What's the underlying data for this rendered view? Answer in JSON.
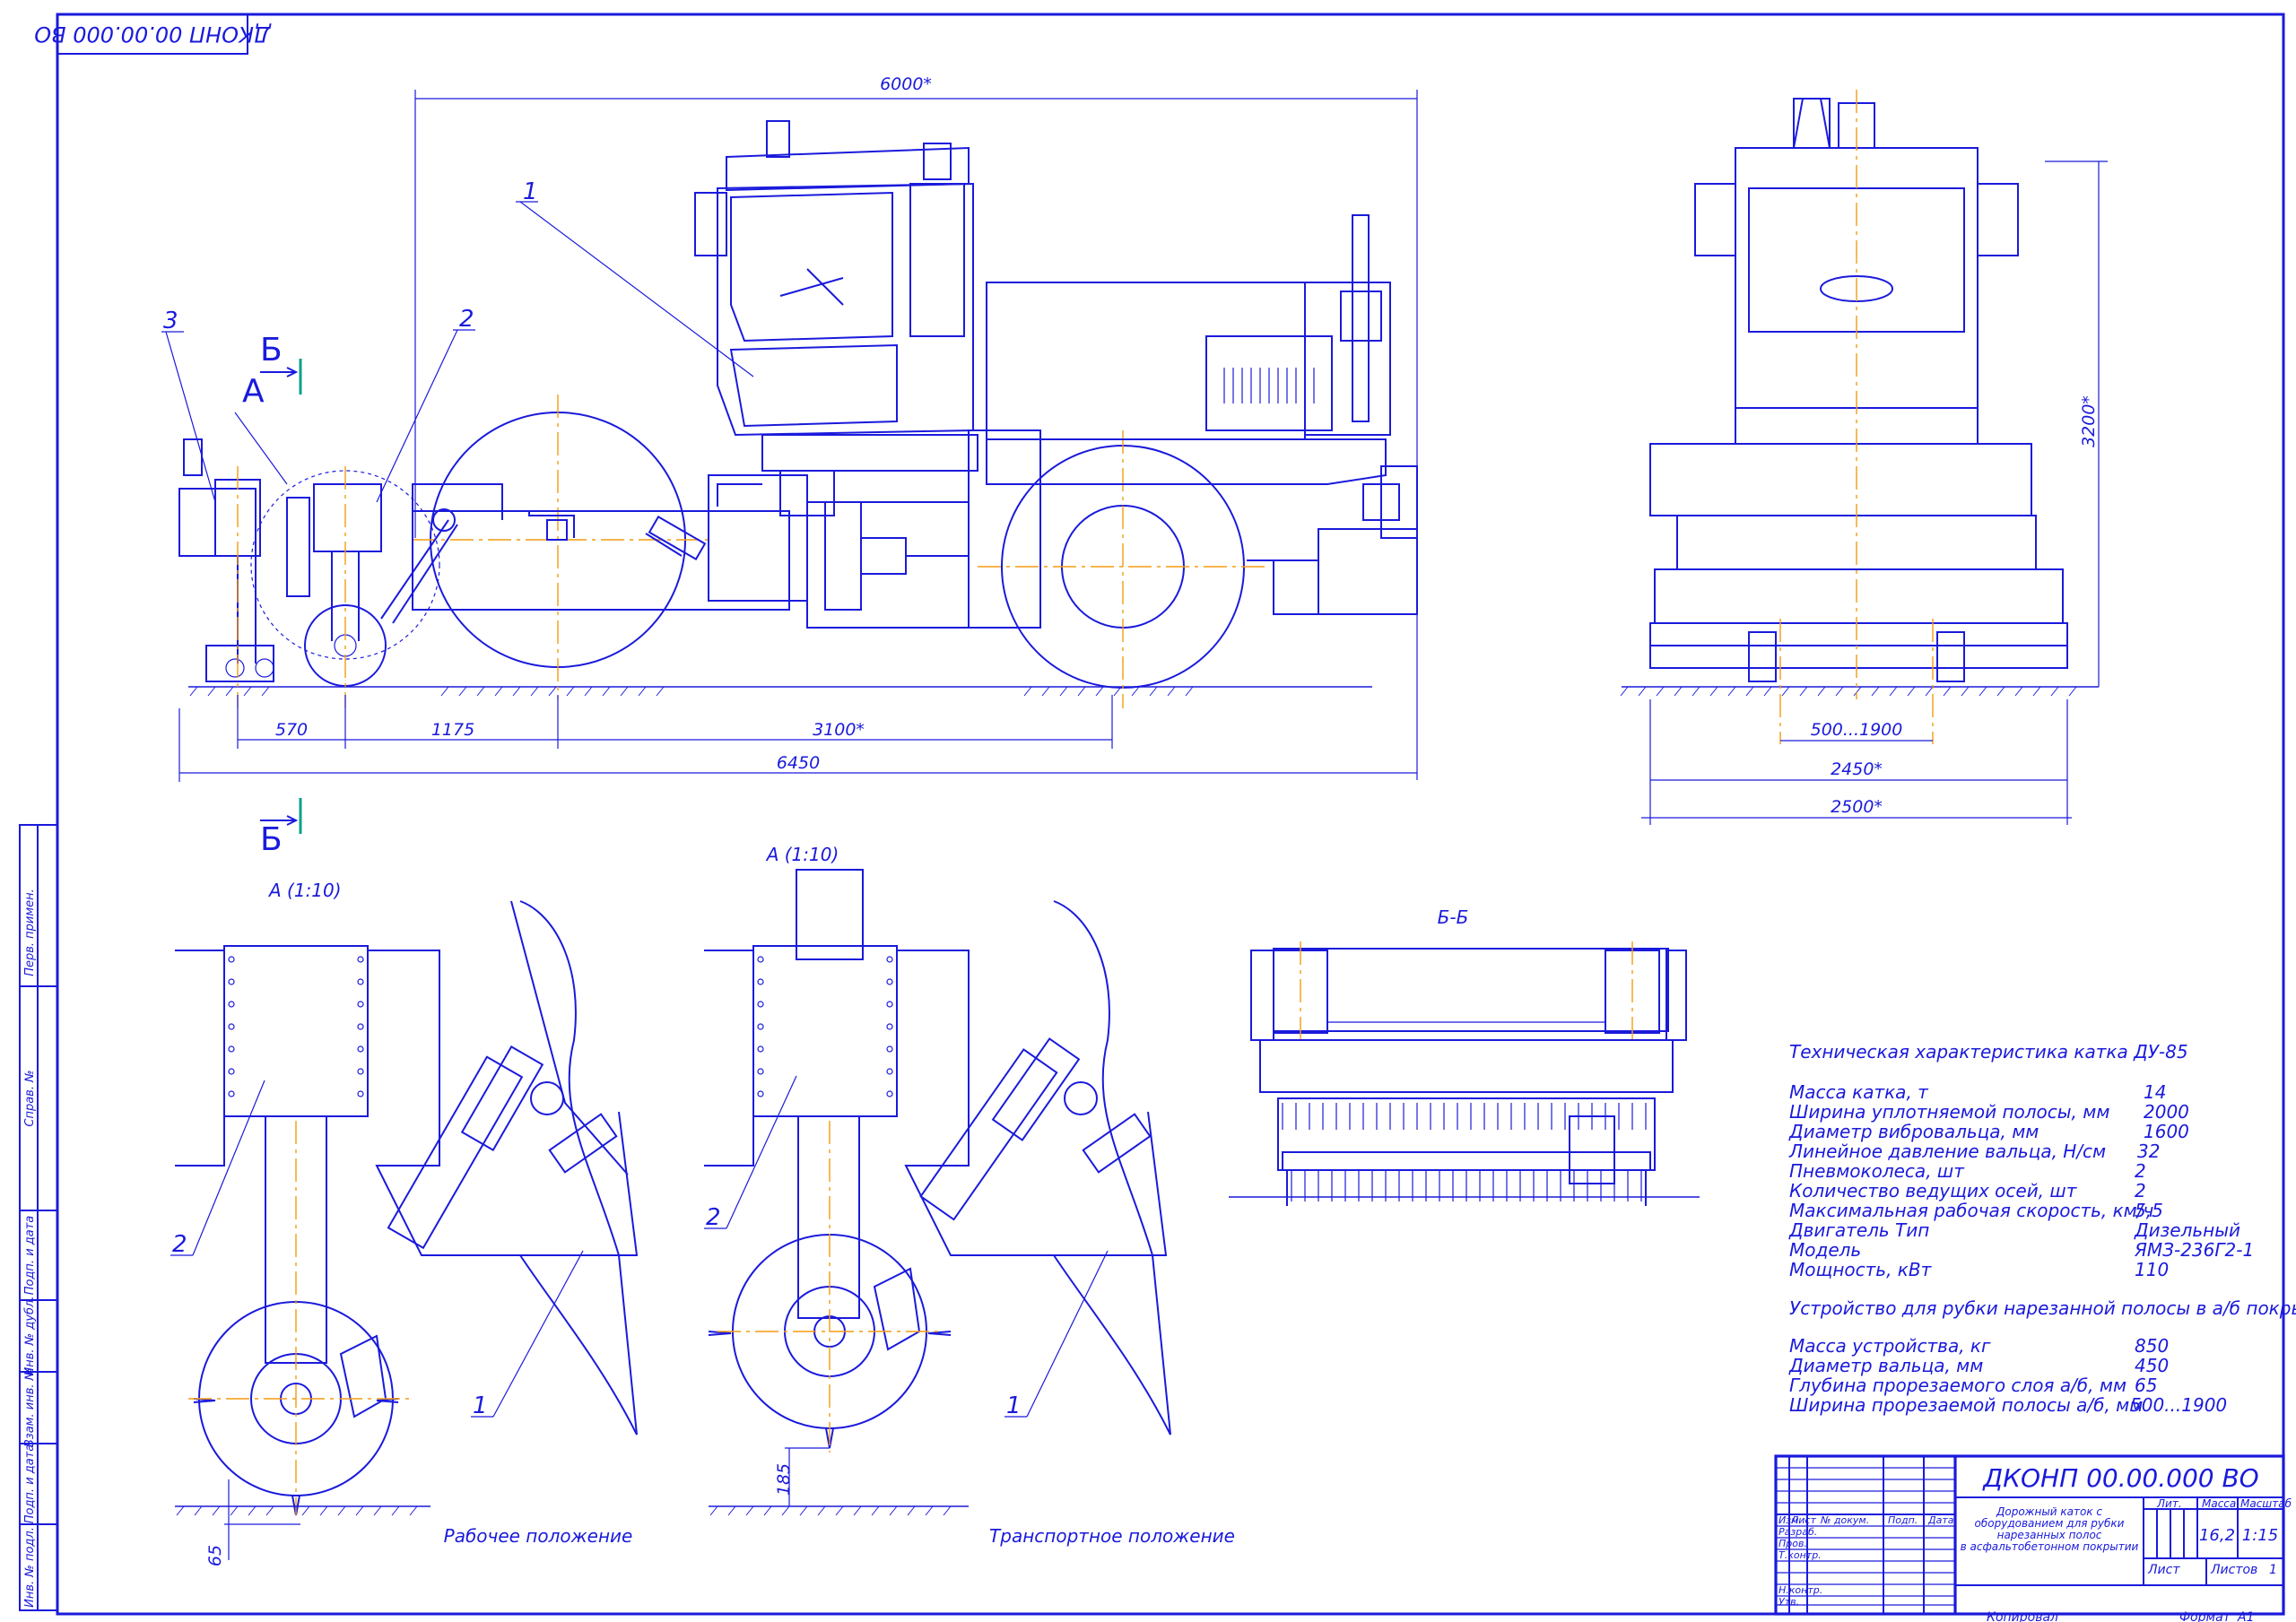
{
  "stamp": {
    "code_rotated": "ДКОНП 00.00.000 ВО"
  },
  "main_view": {
    "dim_total_top": "6000*",
    "dim_height": "3200*",
    "dim_570": "570",
    "dim_1175": "1175",
    "dim_3100": "3100*",
    "dim_6450": "6450",
    "pos_1": "1",
    "pos_2": "2",
    "pos_3": "3",
    "section_b": "Б",
    "view_a": "А"
  },
  "front_view": {
    "dim_500_1900": "500...1900",
    "dim_2450": "2450*",
    "dim_2500": "2500*"
  },
  "detail_work": {
    "title": "А (1:10)",
    "pos_1": "1",
    "pos_2": "2",
    "dim_65": "65",
    "caption": "Рабочее положение"
  },
  "detail_transport": {
    "title": "А (1:10)",
    "pos_1": "1",
    "pos_2": "2",
    "dim_185": "185",
    "caption": "Транспортное положение"
  },
  "section_bb": {
    "title": "Б-Б"
  },
  "specs": {
    "title": "Техническая характеристика катка ДУ-85",
    "rows": [
      {
        "label": "Масса катка, т",
        "value": "14"
      },
      {
        "label": "Ширина уплотняемой полосы, мм",
        "value": "2000"
      },
      {
        "label": "Диаметр вибровальца, мм",
        "value": "1600"
      },
      {
        "label": "Линейное давление вальца, Н/см",
        "value": "32"
      },
      {
        "label": "Пневмоколеса, шт",
        "value": "2"
      },
      {
        "label": "Количество ведущих осей, шт",
        "value": "2"
      },
      {
        "label": "Максимальная рабочая скорость, км/ч",
        "value": "5,5"
      },
      {
        "label": "Двигатель Тип",
        "value": "Дизельный"
      },
      {
        "label": "Модель",
        "value": "ЯМЗ-236Г2-1"
      },
      {
        "label": "Мощность, кВт",
        "value": "110"
      }
    ],
    "subtitle": "Устройство для рубки нарезанной полосы в а/б покрытии",
    "rows2": [
      {
        "label": "Масса устройства, кг",
        "value": "850"
      },
      {
        "label": "Диаметр вальца, мм",
        "value": "450"
      },
      {
        "label": "Глубина прорезаемого слоя а/б, мм",
        "value": "65"
      },
      {
        "label": "Ширина прорезаемой полосы а/б, мм",
        "value": "500...1900"
      }
    ]
  },
  "title_block": {
    "code": "ДКОНП 00.00.000   ВО",
    "name_l1": "Дорожный каток с",
    "name_l2": "оборудованием для рубки",
    "name_l3": "нарезанных полос",
    "name_l4": "в асфальтобетонном покрытии",
    "col_izm": "Изм",
    "col_list": "Лист",
    "col_ndoc": "№ докум.",
    "col_podp": "Подп.",
    "col_data": "Дата",
    "razrab": "Разраб.",
    "prov": "Пров.",
    "tkontr": "Т.контр.",
    "nkontr": "Н.контр.",
    "utv": "Утв.",
    "lit": "Лит.",
    "massa": "Масса",
    "masshtab": "Масштаб",
    "massa_val": "16,2",
    "masshtab_val": "1:15",
    "list": "Лист",
    "listov": "Листов",
    "listov_val": "1",
    "kopiroval": "Копировал",
    "format": "Формат",
    "format_val": "А1"
  },
  "side_strip": [
    "Перв. примен.",
    "Справ. №",
    "Подп. и дата",
    "Инв. № дубл.",
    "Взам. инв. №",
    "Подп. и дата",
    "Инв. № подл."
  ]
}
